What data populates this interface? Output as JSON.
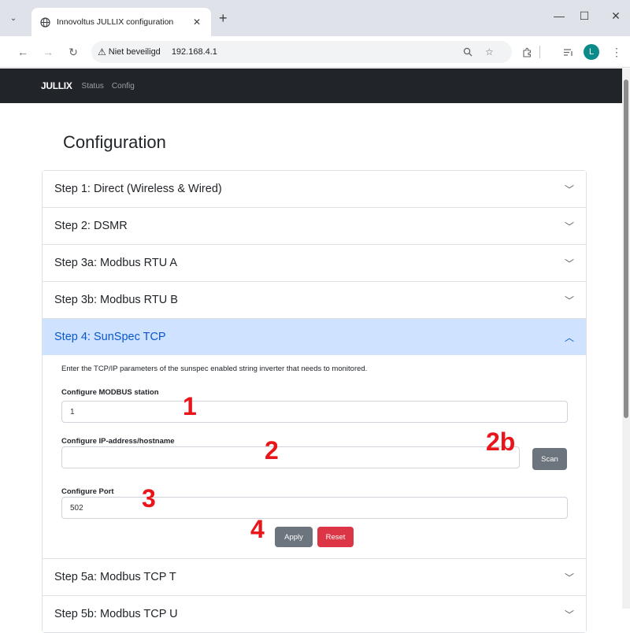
{
  "browser": {
    "tab_title": "Innovoltus JULLIX configuration",
    "tab_close": "✕",
    "new_tab": "+",
    "security_label": "Niet beveiligd",
    "url": "192.168.4.1",
    "profile_initial": "L",
    "window_controls": {
      "minimize": "—",
      "maximize": "☐",
      "close": "✕"
    }
  },
  "navbar": {
    "brand": "JULLIX",
    "links": [
      "Status",
      "Config"
    ]
  },
  "page": {
    "title": "Configuration"
  },
  "accordion": {
    "items": [
      {
        "label": "Step 1: Direct (Wireless & Wired)",
        "expanded": false
      },
      {
        "label": "Step 2: DSMR",
        "expanded": false
      },
      {
        "label": "Step 3a: Modbus RTU A",
        "expanded": false
      },
      {
        "label": "Step 3b: Modbus RTU B",
        "expanded": false
      },
      {
        "label": "Step 4: SunSpec TCP",
        "expanded": true
      },
      {
        "label": "Step 5a: Modbus TCP T",
        "expanded": false
      },
      {
        "label": "Step 5b: Modbus TCP U",
        "expanded": false
      }
    ]
  },
  "sunspec": {
    "description": "Enter the TCP/IP parameters of the sunspec enabled string inverter that needs to monitored.",
    "station_label": "Configure MODBUS station",
    "station_value": "1",
    "ip_label": "Configure IP-address/hostname",
    "ip_value": "",
    "scan_button": "Scan",
    "port_label": "Configure Port",
    "port_value": "502",
    "apply_button": "Apply",
    "reset_button": "Reset"
  },
  "annotations": [
    "1",
    "2",
    "2b",
    "3",
    "4"
  ],
  "colors": {
    "navbar": "#212529",
    "accordion_active_bg": "#cfe2ff",
    "accordion_active_text": "#0a58ca",
    "secondary_button": "#6c757d",
    "danger_button": "#dc3545",
    "annotation": "#e8151b"
  }
}
